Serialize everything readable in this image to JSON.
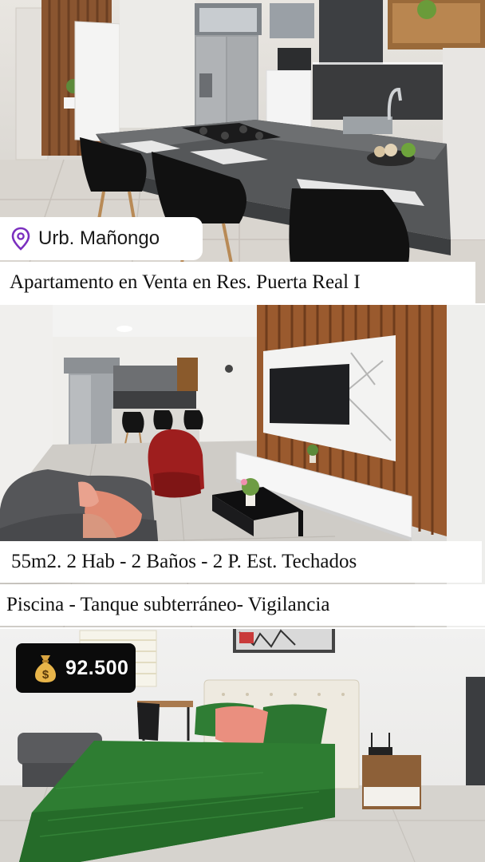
{
  "location": {
    "icon": "map-pin-icon",
    "accent": "#7b2fbf",
    "label": "Urb. Mañongo"
  },
  "listing": {
    "title": "Apartamento en Venta en Res. Puerta Real I",
    "specs": "55m2. 2 Hab - 2 Baños - 2 P. Est. Techados",
    "amenities": "Piscina - Tanque subterráneo- Vigilancia"
  },
  "price": {
    "icon": "money-bag-icon",
    "amount": "92.500"
  },
  "photos": [
    {
      "name": "kitchen-photo"
    },
    {
      "name": "living-room-photo"
    },
    {
      "name": "bedroom-photo"
    }
  ],
  "colors": {
    "caption_bg": "#ffffff",
    "price_badge_bg": "#0b0b0b",
    "bedspread": "#2e7d32",
    "wood_slats": "#9a5a2e"
  }
}
